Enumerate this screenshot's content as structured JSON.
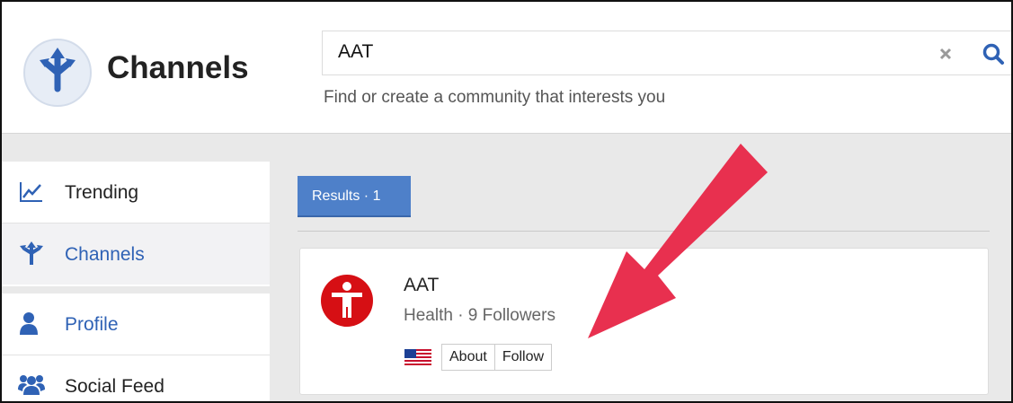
{
  "app": {
    "title": "Channels",
    "logo_icon": "channels-split-arrow-icon"
  },
  "search": {
    "value": "AAT",
    "hint": "Find or create a community that interests you",
    "clear_icon": "close-icon",
    "search_icon": "search-icon"
  },
  "sidebar": {
    "items": [
      {
        "label": "Trending",
        "icon": "trending-chart-icon",
        "color": "#222222",
        "selected": false
      },
      {
        "label": "Channels",
        "icon": "channels-icon",
        "color": "#2f62b5",
        "selected": true
      },
      {
        "label": "Profile",
        "icon": "person-icon",
        "color": "#2f62b5",
        "selected": false
      },
      {
        "label": "Social Feed",
        "icon": "group-icon",
        "color": "#222222",
        "selected": false
      }
    ]
  },
  "results": {
    "tab_label": "Results · 1",
    "items": [
      {
        "name": "AAT",
        "meta": "Health · 9 Followers",
        "flag_icon": "us-flag-icon",
        "about_label": "About",
        "follow_label": "Follow",
        "avatar_color": "#d60f14"
      }
    ]
  },
  "colors": {
    "accent": "#4e80c9",
    "annotation_arrow": "#e8304f"
  }
}
